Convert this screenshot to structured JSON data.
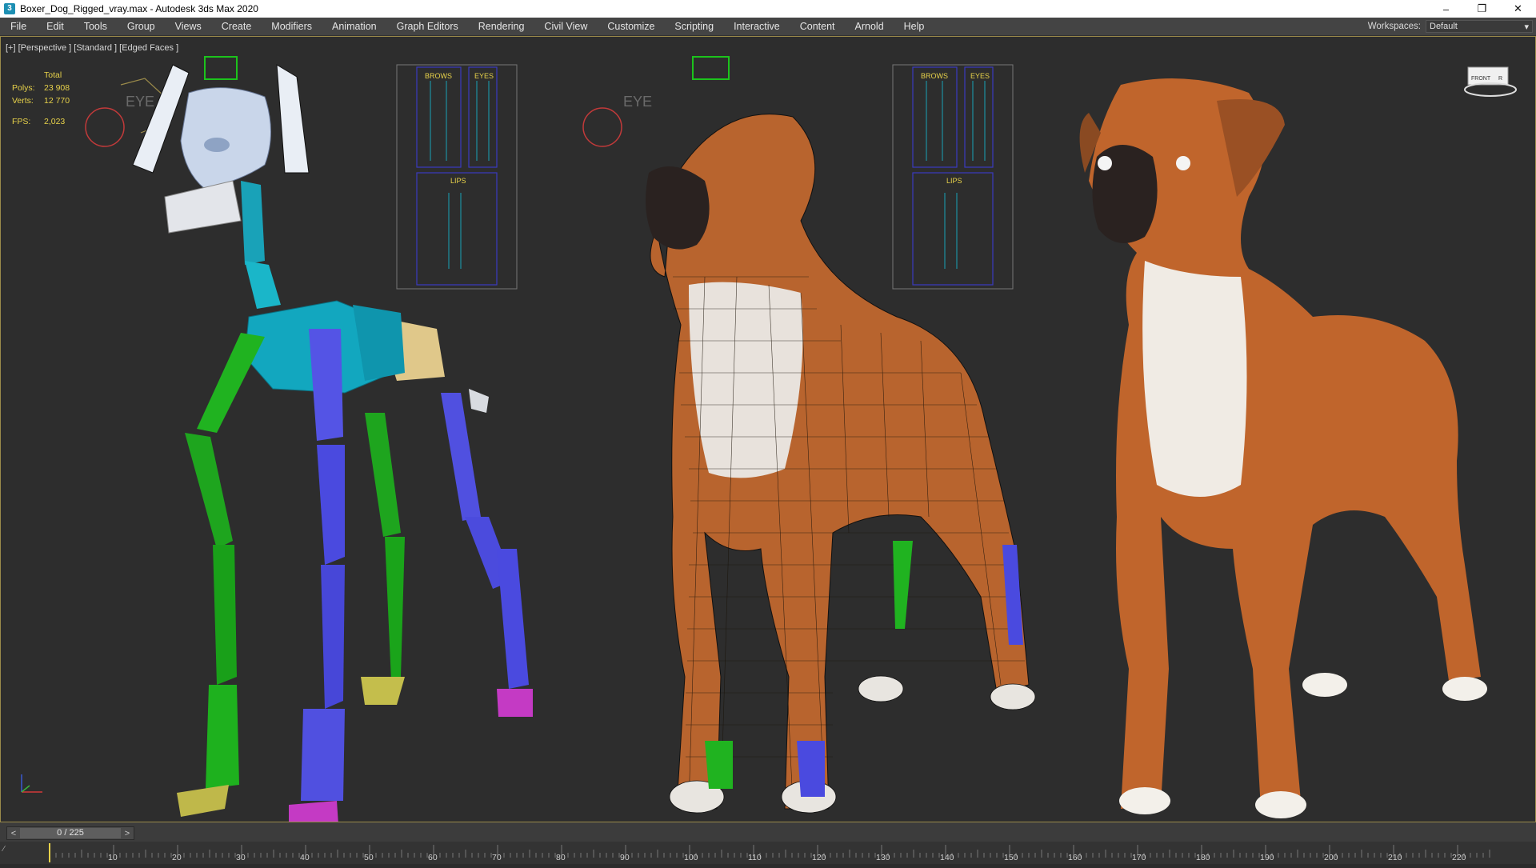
{
  "window": {
    "title": "Boxer_Dog_Rigged_vray.max - Autodesk 3ds Max 2020",
    "icon_letter": "3"
  },
  "menu": [
    "File",
    "Edit",
    "Tools",
    "Group",
    "Views",
    "Create",
    "Modifiers",
    "Animation",
    "Graph Editors",
    "Rendering",
    "Civil View",
    "Customize",
    "Scripting",
    "Interactive",
    "Content",
    "Arnold",
    "Help"
  ],
  "workspace": {
    "label": "Workspaces:",
    "value": "Default"
  },
  "viewport": {
    "label": "[+] [Perspective ] [Standard ] [Edged Faces ]",
    "stats": {
      "header": "Total",
      "polys_label": "Polys:",
      "polys": "23 908",
      "verts_label": "Verts:",
      "verts": "12 770",
      "fps_label": "FPS:",
      "fps": "2,023"
    },
    "face_panel": {
      "brows": "BROWS",
      "eyes": "EYES",
      "lips": "LIPS"
    },
    "eye_control": "EYE",
    "viewcube": {
      "face": "FRONT",
      "side": "R"
    }
  },
  "timeline": {
    "frame": "0 / 225",
    "ticks": [
      "10",
      "20",
      "30",
      "40",
      "50",
      "60",
      "70",
      "80",
      "90",
      "100",
      "110",
      "120",
      "130",
      "140",
      "150",
      "160",
      "170",
      "180",
      "190",
      "200",
      "210",
      "220"
    ]
  },
  "colors": {
    "accent": "#e8d24a",
    "bone_green": "#1fa51f",
    "bone_cyan": "#19a2b8",
    "bone_blue": "#4a4adf",
    "dog_orange": "#c2602a"
  }
}
